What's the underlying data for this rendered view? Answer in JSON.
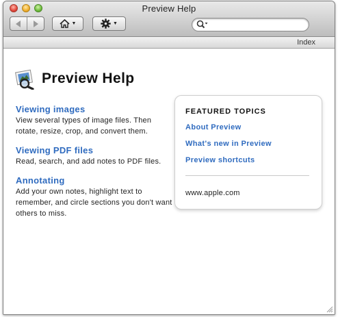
{
  "window": {
    "title": "Preview Help"
  },
  "toolbar": {
    "back_icon": "back-arrow-icon",
    "forward_icon": "forward-arrow-icon",
    "home_icon": "home-icon",
    "action_icon": "gear-icon",
    "search": {
      "value": "",
      "placeholder": ""
    }
  },
  "index_bar": {
    "label": "Index"
  },
  "page": {
    "title": "Preview Help",
    "icon": "preview-app-icon"
  },
  "topics": [
    {
      "title": "Viewing images",
      "description": "View several types of image files. Then rotate, resize, crop, and convert them."
    },
    {
      "title": "Viewing PDF files",
      "description": "Read, search, and add notes to PDF files."
    },
    {
      "title": "Annotating",
      "description": "Add your own notes, highlight text to remember, and circle sections you don't want others to miss."
    }
  ],
  "featured": {
    "heading": "FEATURED TOPICS",
    "links": [
      "About Preview",
      "What's new in Preview",
      "Preview shortcuts"
    ],
    "site": "www.apple.com"
  },
  "colors": {
    "link": "#2f6bbf",
    "text": "#222222"
  }
}
